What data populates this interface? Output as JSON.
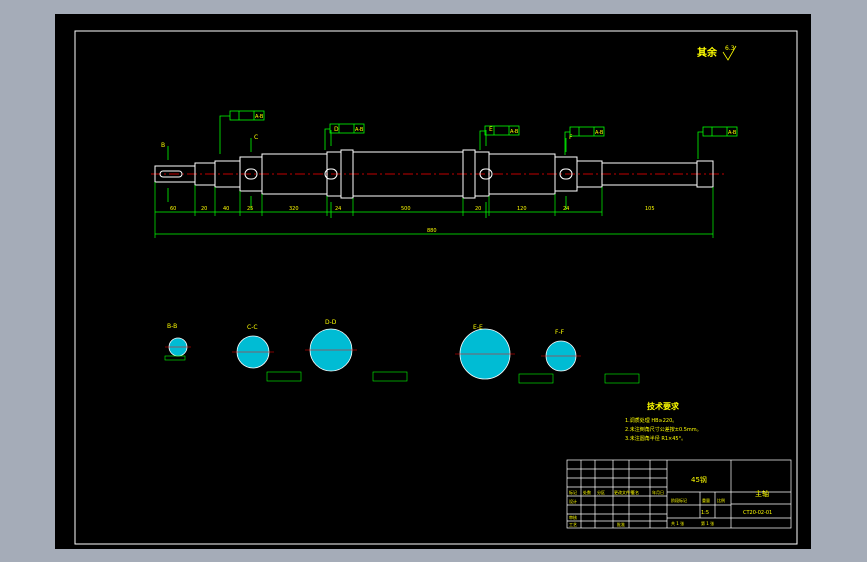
{
  "surface_finish": {
    "label": "其余",
    "value": "6.3"
  },
  "shaft": {
    "datums": [
      "A-B",
      "A-B",
      "A-B",
      "A-B",
      "A-B"
    ],
    "section_labels": [
      "B",
      "C",
      "D",
      "E",
      "F"
    ],
    "dims": [
      "60",
      "20",
      "40",
      "25",
      "320",
      "24",
      "500",
      "20",
      "120",
      "24",
      "105"
    ],
    "overall": "880"
  },
  "sections": [
    "B-B",
    "C-C",
    "D-D",
    "E-E",
    "F-F"
  ],
  "tech_req": {
    "title": "技术要求",
    "items": [
      "1.调质处理 HB≥220。",
      "2.未注倒角尺寸公差按±0.5mm。",
      "3.未注圆角半径 R1×45°。"
    ]
  },
  "title_block": {
    "part_name": "主轴",
    "drawing_no": "CT20-02-01",
    "material": "45钢",
    "scale": "1:5",
    "labels": [
      "标记",
      "处数",
      "分区",
      "更改文件号",
      "签名",
      "年月日",
      "设计",
      "审核",
      "工艺",
      "批准",
      "阶段标记",
      "重量",
      "比例",
      "共 1 张",
      "第 1 张"
    ]
  },
  "colors": {
    "sheet": "#000000",
    "lines": "#ffffff",
    "dims": "#00ff00",
    "text": "#ffff00",
    "centerline": "#ff0000",
    "hatch": "#00ffff"
  }
}
